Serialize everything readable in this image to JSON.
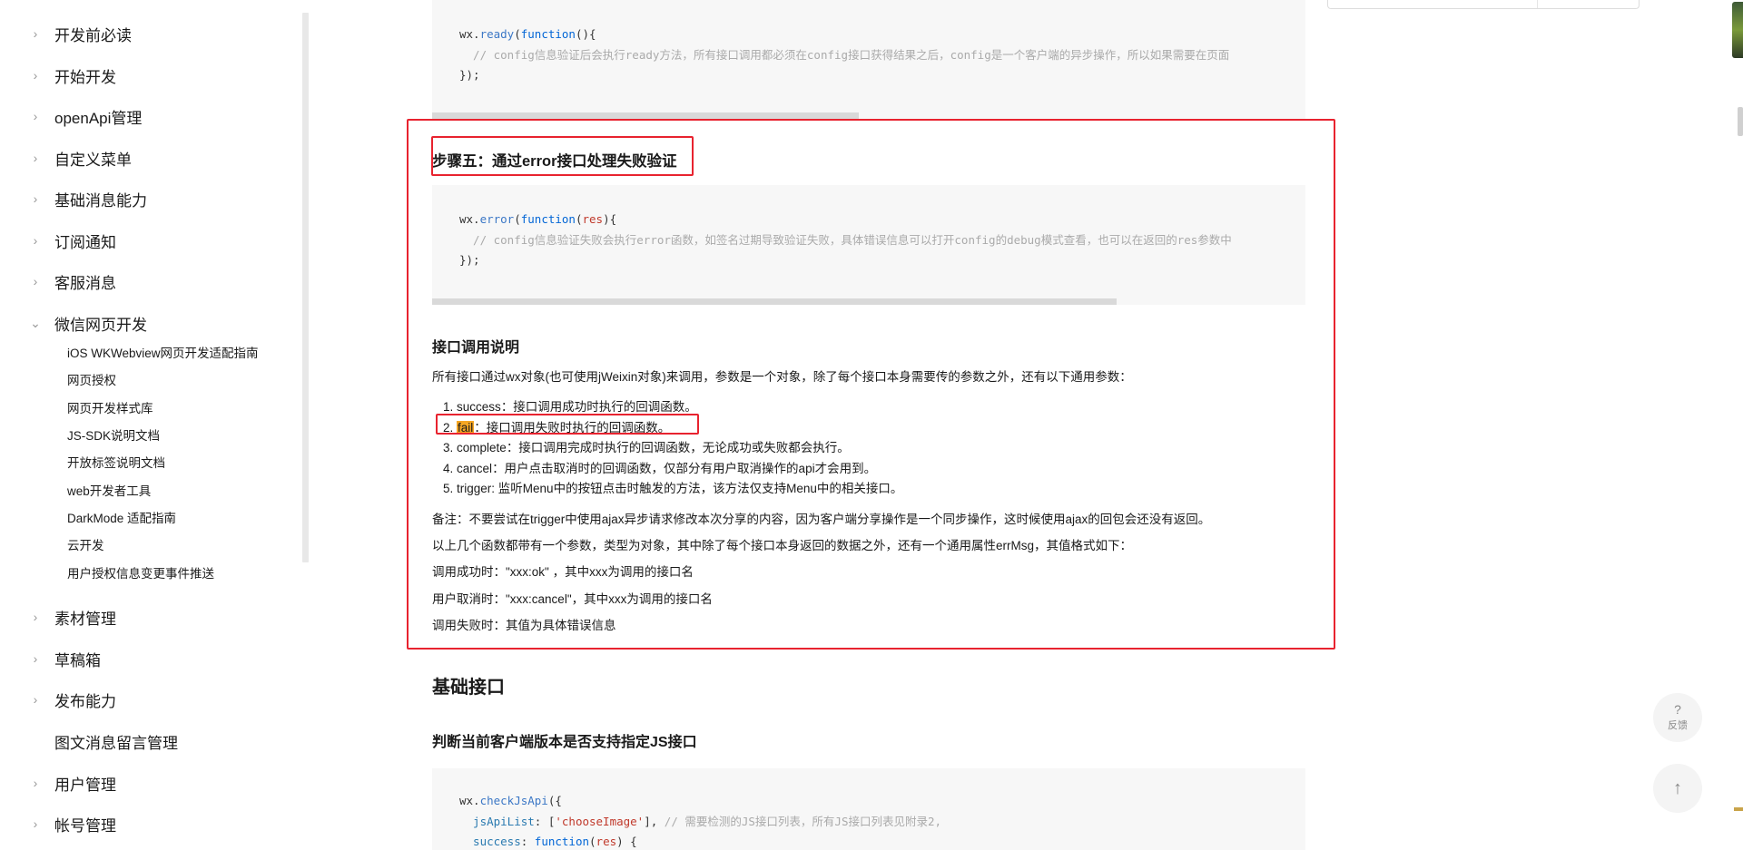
{
  "sidebar": {
    "items": [
      {
        "label": "开发前必读",
        "chevron": ">"
      },
      {
        "label": "开始开发",
        "chevron": ">"
      },
      {
        "label": "openApi管理",
        "chevron": ">"
      },
      {
        "label": "自定义菜单",
        "chevron": ">"
      },
      {
        "label": "基础消息能力",
        "chevron": ">"
      },
      {
        "label": "订阅通知",
        "chevron": ">"
      },
      {
        "label": "客服消息",
        "chevron": ">"
      },
      {
        "label": "微信网页开发",
        "chevron": "v"
      },
      {
        "label": "素材管理",
        "chevron": ">"
      },
      {
        "label": "草稿箱",
        "chevron": ">"
      },
      {
        "label": "发布能力",
        "chevron": ">"
      },
      {
        "label": "图文消息留言管理",
        "chevron": ""
      },
      {
        "label": "用户管理",
        "chevron": ">"
      },
      {
        "label": "帐号管理",
        "chevron": ">"
      }
    ],
    "subitems": [
      "iOS WKWebview网页开发适配指南",
      "网页授权",
      "网页开发样式库",
      "JS-SDK说明文档",
      "开放标签说明文档",
      "web开发者工具",
      "DarkMode 适配指南",
      "云开发",
      "用户授权信息变更事件推送"
    ]
  },
  "main": {
    "code1": {
      "l1a": "wx.",
      "l1b": "ready",
      "l1c": "(",
      "l1d": "function",
      "l1e": "(){",
      "l2": "  // config信息验证后会执行ready方法，所有接口调用都必须在config接口获得结果之后，config是一个客户端的异步操作，所以如果需要在页面",
      "l3": "});"
    },
    "step5_title": "步骤五：通过error接口处理失败验证",
    "code2": {
      "l1a": "wx.",
      "l1b": "error",
      "l1c": "(",
      "l1d": "function",
      "l1e": "(",
      "l1f": "res",
      "l1g": "){",
      "l2": "  // config信息验证失败会执行error函数，如签名过期导致验证失败，具体错误信息可以打开config的debug模式查看，也可以在返回的res参数中",
      "l3": "});"
    },
    "api_heading": "接口调用说明",
    "api_intro": "所有接口通过wx对象(也可使用jWeixin对象)来调用，参数是一个对象，除了每个接口本身需要传的参数之外，还有以下通用参数：",
    "list": [
      {
        "num": "1.",
        "key": "success",
        "text": "：接口调用成功时执行的回调函数。"
      },
      {
        "num": "2.",
        "key": "fail",
        "text": "：接口调用失败时执行的回调函数。"
      },
      {
        "num": "3.",
        "key": "complete",
        "text": "：接口调用完成时执行的回调函数，无论成功或失败都会执行。"
      },
      {
        "num": "4.",
        "key": "cancel",
        "text": "：用户点击取消时的回调函数，仅部分有用户取消操作的api才会用到。"
      },
      {
        "num": "5.",
        "key": "trigger",
        "text": ": 监听Menu中的按钮点击时触发的方法，该方法仅支持Menu中的相关接口。"
      }
    ],
    "note": "备注：不要尝试在trigger中使用ajax异步请求修改本次分享的内容，因为客户端分享操作是一个同步操作，这时候使用ajax的回包会还没有返回。",
    "p2": "以上几个函数都带有一个参数，类型为对象，其中除了每个接口本身返回的数据之外，还有一个通用属性errMsg，其值格式如下：",
    "p3": "调用成功时：\"xxx:ok\" ，其中xxx为调用的接口名",
    "p4": "用户取消时：\"xxx:cancel\"，其中xxx为调用的接口名",
    "p5": "调用失败时：其值为具体错误信息",
    "basic_heading": "基础接口",
    "check_heading": "判断当前客户端版本是否支持指定JS接口",
    "code3": {
      "l1a": "wx.",
      "l1b": "checkJsApi",
      "l1c": "({",
      "l2a": "  jsApiList",
      "l2b": ": [",
      "l2c": "'chooseImage'",
      "l2d": "], ",
      "l2e": "// 需要检测的JS接口列表，所有JS接口列表见附录2,",
      "l3a": "  success",
      "l3b": ": ",
      "l3c": "function",
      "l3d": "(",
      "l3e": "res",
      "l3f": ") {"
    }
  },
  "widgets": {
    "feedback_icon": "?",
    "feedback_label": "反馈",
    "back_to_top_icon": "↑"
  },
  "colors": {
    "annotation_red": "#e8232f",
    "highlight": "#f5a623",
    "code_bg": "#f7f7f7"
  }
}
